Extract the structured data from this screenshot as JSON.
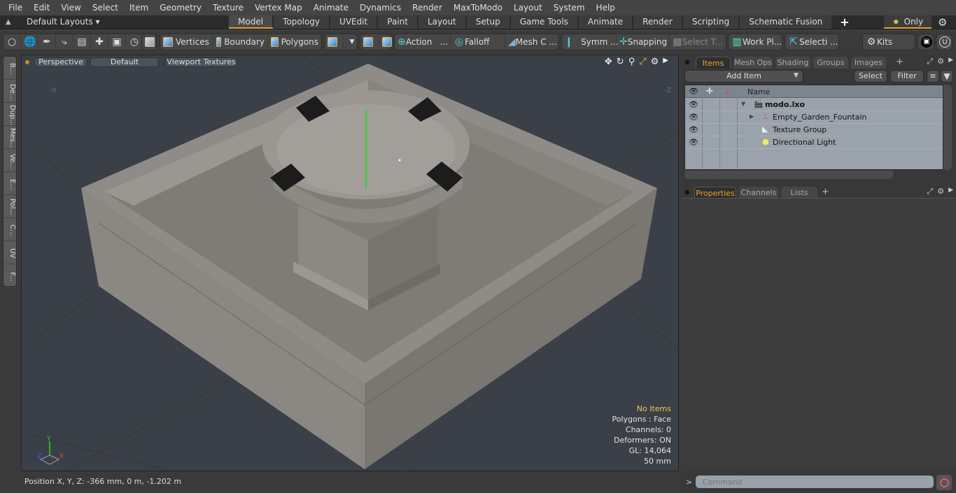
{
  "menu": [
    "File",
    "Edit",
    "View",
    "Select",
    "Item",
    "Geometry",
    "Texture",
    "Vertex Map",
    "Animate",
    "Dynamics",
    "Render",
    "MaxToModo",
    "Layout",
    "System",
    "Help"
  ],
  "layout_bar": {
    "layouts_label": "Default Layouts ▾",
    "tabs": [
      "Model",
      "Topology",
      "UVEdit",
      "Paint",
      "Layout",
      "Setup",
      "Game Tools",
      "Animate",
      "Render",
      "Scripting",
      "Schematic Fusion"
    ],
    "active_tab": "Model",
    "add_tab": "+",
    "only_label": "Only"
  },
  "toolbar": {
    "vertices": "Vertices",
    "boundary": "Boundary",
    "polygons": "Polygons",
    "action": "Action",
    "action_more": "...",
    "falloff": "Falloff",
    "mesh_c": "Mesh C ...",
    "symm": "Symm ...",
    "snapping": "Snapping",
    "select_t": "Select T...",
    "work_pl": "Work Pl...",
    "selecti": "Selecti ...",
    "kits": "Kits"
  },
  "left_tabs": [
    "B...",
    "De...",
    "Dup...",
    "Mes...",
    "Ve...",
    "E...",
    "Pol...",
    "C...",
    "UV",
    "F..."
  ],
  "viewport": {
    "view_mode": "Perspective",
    "shading": "Default",
    "textures": "Viewport Textures",
    "axis_x_label": "-X",
    "axis_z_label": "-Z",
    "gizmo": {
      "x": "X",
      "y": "Y",
      "z": "Z"
    },
    "info": {
      "selection": "No Items",
      "polygons": "Polygons : Face",
      "channels": "Channels: 0",
      "deformers": "Deformers: ON",
      "gl": "GL: 14,064",
      "scale": "50 mm"
    }
  },
  "status": {
    "position": "Position X, Y, Z:   -366 mm, 0 m, -1.202 m"
  },
  "items_panel": {
    "tabs": [
      "Items",
      "Mesh Ops",
      "Shading",
      "Groups",
      "Images"
    ],
    "active_tab": "Items",
    "add_item": "Add Item",
    "select": "Select",
    "filter": "Filter",
    "column_name": "Name",
    "items": [
      {
        "name": "modo.lxo",
        "level": 0,
        "icon": "scene-icon",
        "bold": true
      },
      {
        "name": "Empty_Garden_Fountain",
        "level": 1,
        "icon": "locator-icon"
      },
      {
        "name": "Texture Group",
        "level": 1,
        "icon": "texture-group-icon"
      },
      {
        "name": "Directional Light",
        "level": 1,
        "icon": "light-icon"
      }
    ]
  },
  "properties_panel": {
    "tabs": [
      "Properties",
      "Channels",
      "Lists"
    ],
    "active_tab": "Properties"
  },
  "command": {
    "prompt": ">",
    "placeholder": "Command"
  },
  "colors": {
    "accent": "#e89a2c",
    "viewport_bg": "#3b4048",
    "list_bg": "#9aa3ab"
  }
}
